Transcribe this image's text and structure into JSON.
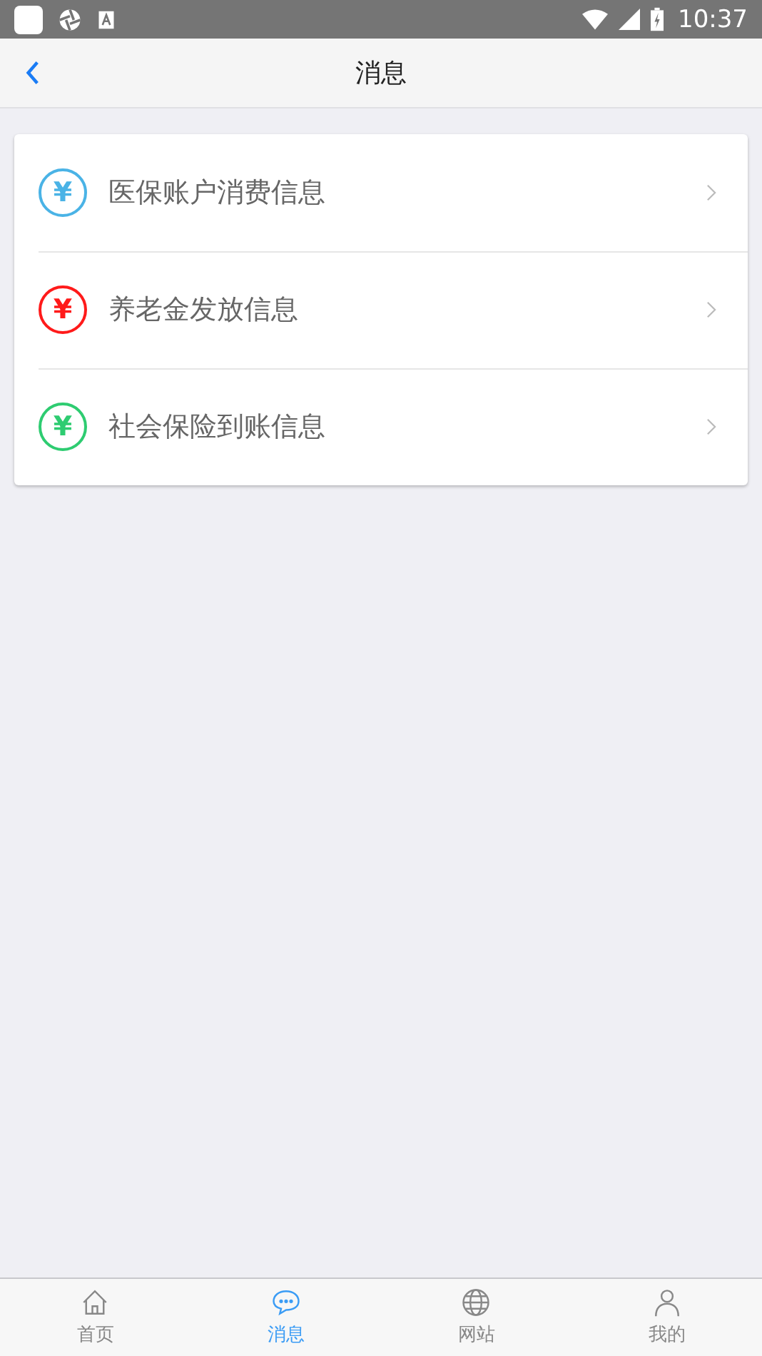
{
  "status_bar": {
    "time": "10:37"
  },
  "header": {
    "title": "消息"
  },
  "messages": [
    {
      "label": "医保账户消费信息",
      "glyph": "¥",
      "color": "#4ab3e6"
    },
    {
      "label": "养老金发放信息",
      "glyph": "¥",
      "color": "#ff1a1a"
    },
    {
      "label": "社会保险到账信息",
      "glyph": "¥",
      "color": "#2ecc71"
    }
  ],
  "tabs": [
    {
      "label": "首页",
      "kind": "home",
      "selected": false
    },
    {
      "label": "消息",
      "kind": "chat",
      "selected": true
    },
    {
      "label": "网站",
      "kind": "globe",
      "selected": false
    },
    {
      "label": "我的",
      "kind": "person",
      "selected": false
    }
  ]
}
